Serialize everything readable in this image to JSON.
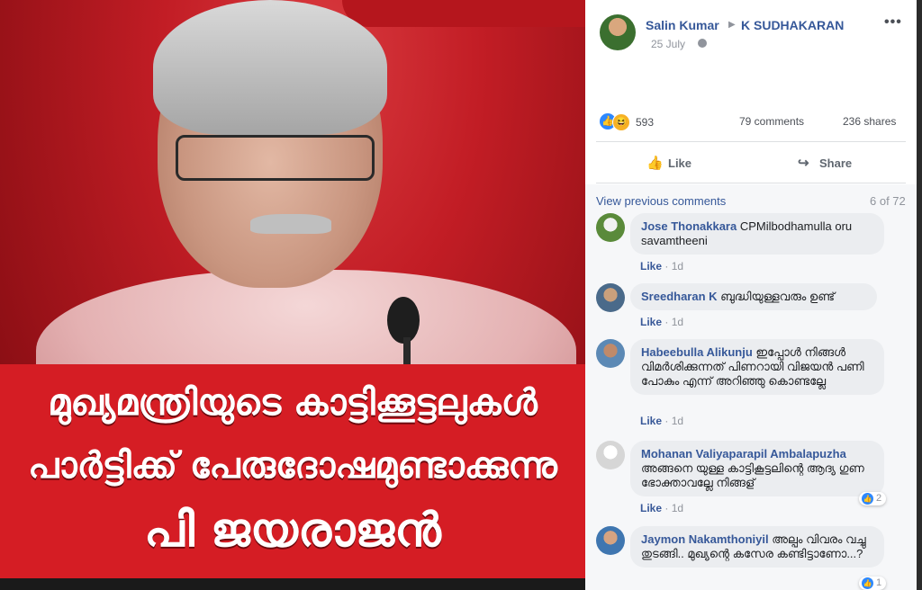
{
  "photo": {
    "line1": "മുഖ്യമന്ത്രിയുടെ കാട്ടിക്കൂട്ടലുകൾ",
    "line2": "പാർട്ടിക്ക് പേരുദോഷമുണ്ടാക്കുന്നു",
    "line3": "പി ജയരാജൻ"
  },
  "post": {
    "author": "Salin Kumar",
    "target": "K SUDHAKARAN",
    "date": "25 July",
    "more": "•••"
  },
  "stats": {
    "reactions": "593",
    "comments": "79 comments",
    "shares": "236 shares"
  },
  "actions": {
    "like": "Like",
    "share": "Share"
  },
  "comments_header": {
    "view_previous": "View previous comments",
    "count": "6 of 72"
  },
  "comments": [
    {
      "name": "Jose Thonakkara",
      "text": "CPMilbodhamulla oru savamtheeni",
      "like": "Like",
      "time": "1d"
    },
    {
      "name": "Sreedharan K",
      "text": "ബുദ്ധിയുള്ളവരും ഉണ്ട്",
      "like": "Like",
      "time": "1d"
    },
    {
      "name": "Habeebulla Alikunju",
      "text": "ഇപ്പോൾ നിങ്ങൾ വിമർശിക്കുന്നത് പിണറായി വിജയൻ പണി പോകും എന്ന് അറിഞ്ഞു കൊണ്ടല്ലേ",
      "like": "Like",
      "time": "1d"
    },
    {
      "name": "Mohanan Valiyaparapil Ambalapuzha",
      "text": "അങ്ങനെ യുള്ള കാട്ടികൂട്ടലിന്റെ ആദ്യ ഗുണ ഭോക്താവല്ലേ നിങ്ങള്",
      "like": "Like",
      "time": "1d",
      "reactions": "2"
    },
    {
      "name": "Jaymon Nakamthoniyil",
      "text": "അല്പം വിവരം വച്ചു തുടങ്ങി.. മുഖ്യന്റെ കസേര കണ്ടിട്ടാണോ...?",
      "reactions": "1"
    }
  ]
}
